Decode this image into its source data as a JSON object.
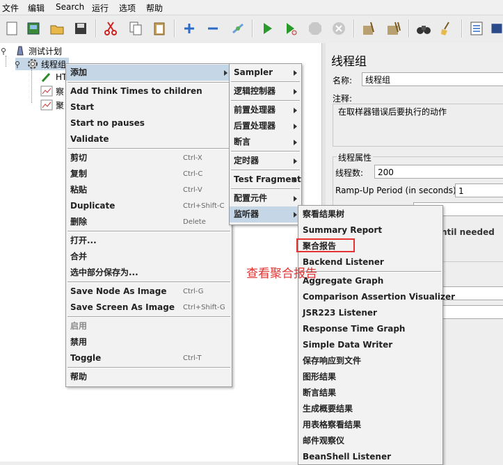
{
  "menubar": {
    "items": [
      {
        "label": "文件"
      },
      {
        "label": "编辑"
      },
      {
        "label": "Search"
      },
      {
        "label": "运行"
      },
      {
        "label": "选项"
      },
      {
        "label": "帮助"
      }
    ]
  },
  "tree": {
    "plan_label": "测试计划",
    "thread_group_label": "线程组",
    "child1_label": "HT",
    "child2_label": "察",
    "child3_label": "聚"
  },
  "right_panel": {
    "title": "线程组",
    "name_label": "名称:",
    "name_value": "线程组",
    "comment_label": "注释:",
    "error_action_label": "在取样器错误后要执行的动作",
    "thread_props_label": "线程属性",
    "thread_count_label": "线程数:",
    "thread_count_value": "200",
    "rampup_label": "Ramp-Up Period (in seconds):",
    "rampup_value": "1",
    "until_needed_text": "ntil needed"
  },
  "context_menu": {
    "add": "添加",
    "add_think_times": "Add Think Times to children",
    "start": "Start",
    "start_no_pauses": "Start no pauses",
    "validate": "Validate",
    "cut": "剪切",
    "cut_acc": "Ctrl-X",
    "copy": "复制",
    "copy_acc": "Ctrl-C",
    "paste": "粘贴",
    "paste_acc": "Ctrl-V",
    "duplicate": "Duplicate",
    "duplicate_acc": "Ctrl+Shift-C",
    "delete": "删除",
    "delete_acc": "Delete",
    "open": "打开...",
    "merge": "合并",
    "save_selection": "选中部分保存为...",
    "save_node_image": "Save Node As Image",
    "save_node_image_acc": "Ctrl-G",
    "save_screen_image": "Save Screen As Image",
    "save_screen_image_acc": "Ctrl+Shift-G",
    "enable": "启用",
    "disable": "禁用",
    "toggle": "Toggle",
    "toggle_acc": "Ctrl-T",
    "help": "帮助"
  },
  "add_submenu": {
    "sampler": "Sampler",
    "logic_controller": "逻辑控制器",
    "pre_processor": "前置处理器",
    "post_processor": "后置处理器",
    "assertion": "断言",
    "timer": "定时器",
    "test_fragment": "Test Fragment",
    "config_element": "配置元件",
    "listener": "监听器"
  },
  "listener_submenu": {
    "items": [
      "察看结果树",
      "Summary Report",
      "聚合报告",
      "Backend Listener",
      "Aggregate Graph",
      "Comparison Assertion Visualizer",
      "JSR223 Listener",
      "Response Time Graph",
      "Simple Data Writer",
      "保存响应到文件",
      "图形结果",
      "断言结果",
      "生成概要结果",
      "用表格察看结果",
      "邮件观察仪",
      "BeanShell Listener"
    ]
  },
  "annotation": "查看聚合报告",
  "colors": {
    "menu_bg": "#f2f2f2",
    "selection": "#c5d6e6",
    "annotation_red": "#e03434"
  }
}
